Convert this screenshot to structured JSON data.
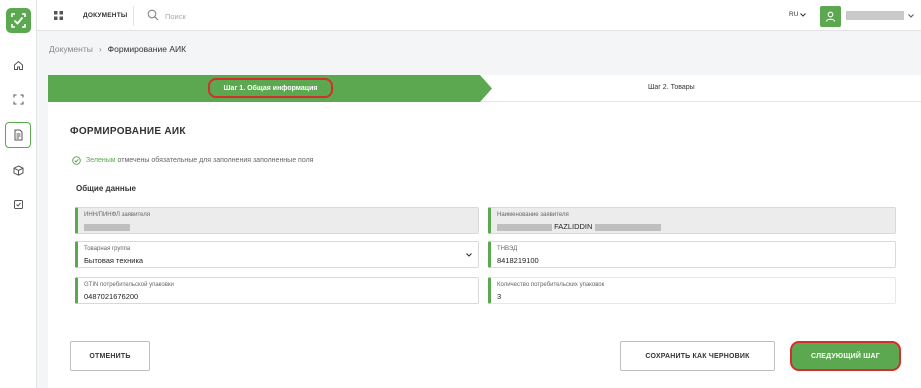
{
  "topbar": {
    "docs_label": "ДОКУМЕНТЫ",
    "search_placeholder": "Поиск",
    "lang": "RU"
  },
  "breadcrumb": {
    "root": "Документы",
    "separator": "›",
    "current": "Формирование АИК"
  },
  "stepper": {
    "step1": "Шаг 1. Общая информация",
    "step2": "Шаг 2. Товары"
  },
  "form": {
    "title": "ФОРМИРОВАНИЕ АИК",
    "note_green": "Зеленым",
    "note_rest": "отмечены обязательные для заполнения заполненные поля",
    "section": "Общие данные",
    "fields": {
      "inn": {
        "label": "ИНН/ПИНФЛ заявителя"
      },
      "applicant_name": {
        "label": "Наименование заявителя",
        "value_visible": "FAZLIDDIN"
      },
      "product_group": {
        "label": "Товарная группа",
        "value": "Бытовая техника"
      },
      "tnved": {
        "label": "ТНВЭД",
        "value": "8418219100"
      },
      "gtin": {
        "label": "GTIN потребительской упаковки",
        "value": "0487021676200"
      },
      "pack_count": {
        "label": "Количество потребительских упаковок",
        "value": "3"
      }
    }
  },
  "buttons": {
    "cancel": "ОТМЕНИТЬ",
    "save_draft": "СОХРАНИТЬ КАК ЧЕРНОВИК",
    "next": "СЛЕДУЮЩИЙ ШАГ"
  },
  "colors": {
    "brand_green": "#5ba850",
    "highlight_red": "#d32f2f"
  },
  "icons": [
    "logo-check-icon",
    "home-icon",
    "scan-icon",
    "document-icon",
    "box-icon",
    "checklist-icon",
    "grid-icon",
    "search-icon",
    "user-icon",
    "chevron-down-icon",
    "check-circle-icon"
  ]
}
